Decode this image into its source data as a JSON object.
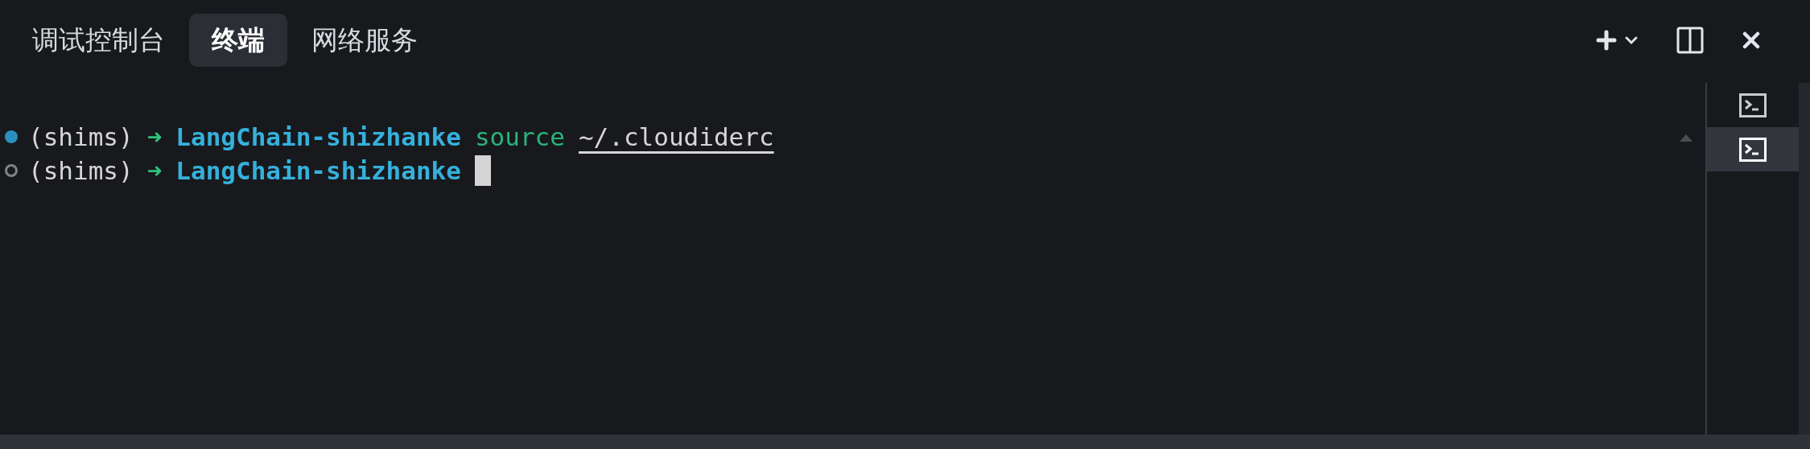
{
  "tabs": [
    {
      "label": "调试控制台",
      "selected": false
    },
    {
      "label": "终端",
      "selected": true
    },
    {
      "label": "网络服务",
      "selected": false
    }
  ],
  "terminal": {
    "lines": [
      {
        "active": true,
        "cursor": false,
        "segments": [
          {
            "text": "(shims)",
            "kind": "plain"
          },
          {
            "text": "➜",
            "kind": "arrow"
          },
          {
            "text": "LangChain-shizhanke",
            "kind": "dir"
          },
          {
            "text": "source",
            "kind": "command"
          },
          {
            "text": "~/.cloudiderc",
            "kind": "path"
          }
        ]
      },
      {
        "active": false,
        "cursor": true,
        "segments": [
          {
            "text": "(shims)",
            "kind": "plain"
          },
          {
            "text": "➜",
            "kind": "arrow"
          },
          {
            "text": "LangChain-shizhanke",
            "kind": "dir"
          }
        ]
      }
    ]
  },
  "terminal_list": [
    {
      "selected": false
    },
    {
      "selected": true
    }
  ]
}
